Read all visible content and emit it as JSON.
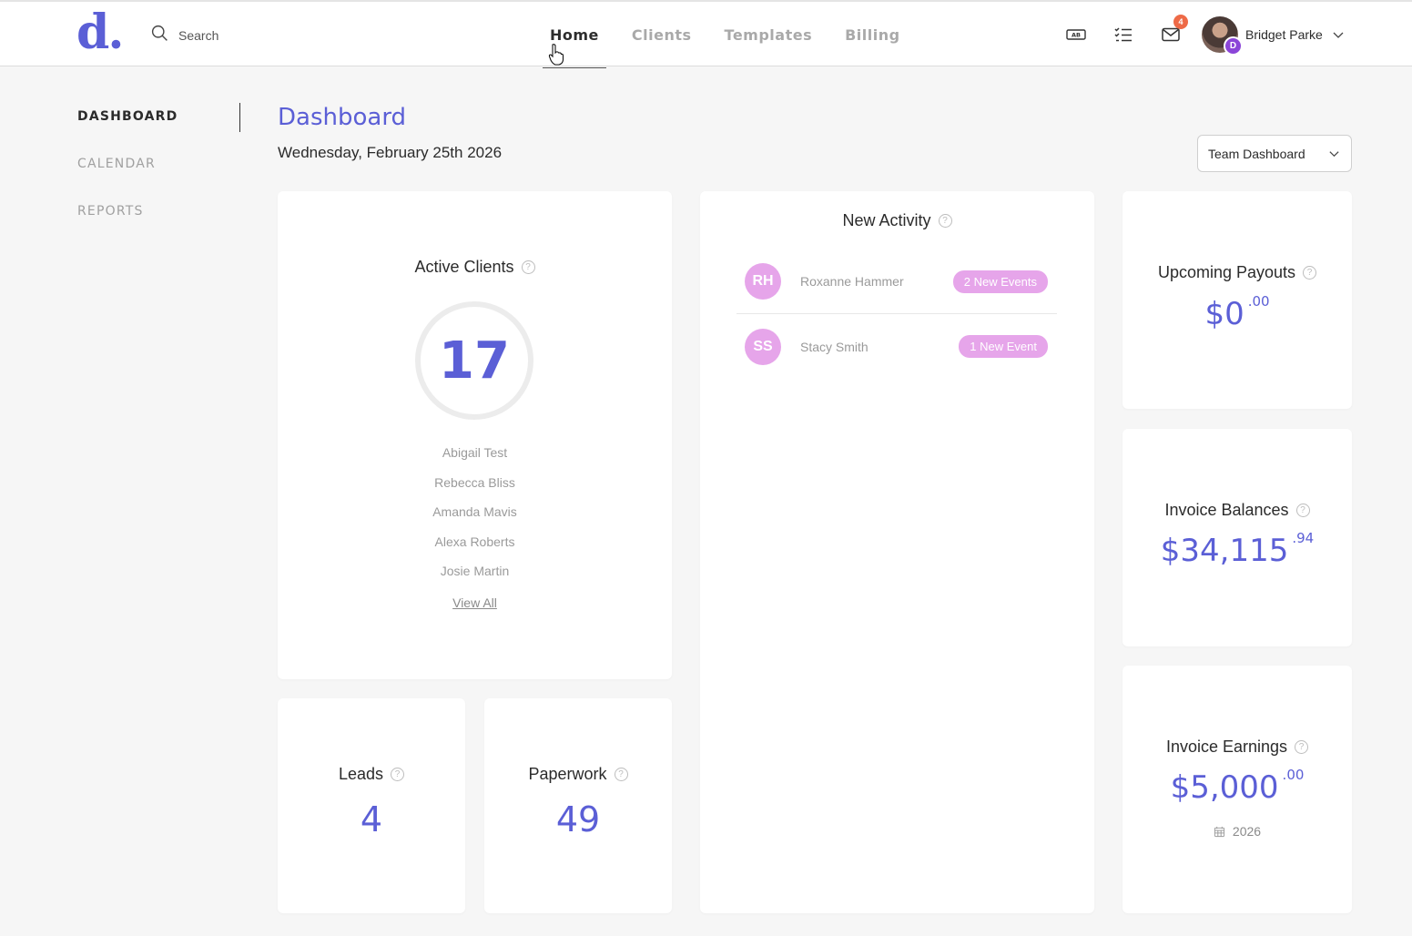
{
  "header": {
    "logo": "d.",
    "search_placeholder": "Search",
    "nav": [
      {
        "label": "Home",
        "active": true
      },
      {
        "label": "Clients",
        "active": false
      },
      {
        "label": "Templates",
        "active": false
      },
      {
        "label": "Billing",
        "active": false
      }
    ],
    "icons": [
      "ab-keyboard-icon",
      "checklist-icon",
      "mail-icon"
    ],
    "mail_badge": "4",
    "user": {
      "name": "Bridget Parke",
      "avatar_badge": "D"
    }
  },
  "sidebar": {
    "items": [
      {
        "label": "DASHBOARD",
        "active": true
      },
      {
        "label": "CALENDAR",
        "active": false
      },
      {
        "label": "REPORTS",
        "active": false
      }
    ]
  },
  "page": {
    "title": "Dashboard",
    "date": "Wednesday, February 25th 2026",
    "dashboard_select": "Team Dashboard"
  },
  "active_clients": {
    "title": "Active Clients",
    "count": "17",
    "clients": [
      "Abigail Test",
      "Rebecca Bliss",
      "Amanda Mavis",
      "Alexa Roberts",
      "Josie Martin"
    ],
    "view_all": "View All"
  },
  "new_activity": {
    "title": "New Activity",
    "items": [
      {
        "initials": "RH",
        "name": "Roxanne Hammer",
        "events": "2 New Events"
      },
      {
        "initials": "SS",
        "name": "Stacy Smith",
        "events": "1 New Event"
      }
    ]
  },
  "leads": {
    "title": "Leads",
    "value": "4"
  },
  "paperwork": {
    "title": "Paperwork",
    "value": "49"
  },
  "upcoming_payouts": {
    "title": "Upcoming Payouts",
    "amount": "$0",
    "cents": ".00"
  },
  "invoice_balances": {
    "title": "Invoice Balances",
    "amount": "$34,115",
    "cents": ".94"
  },
  "invoice_earnings": {
    "title": "Invoice Earnings",
    "amount": "$5,000",
    "cents": ".00",
    "year": "2026"
  },
  "colors": {
    "accent": "#5b5fd6",
    "pill": "#e6a5ea",
    "badge": "#ee6a47",
    "avatar_badge": "#8b45d8"
  }
}
